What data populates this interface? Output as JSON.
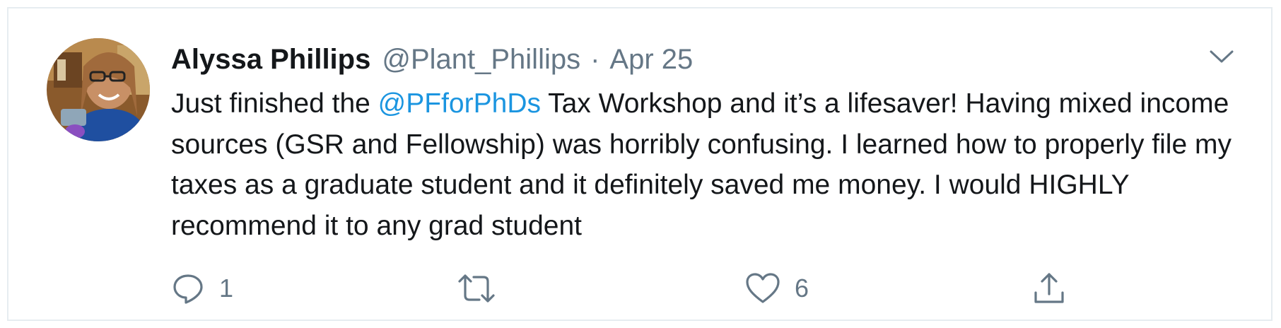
{
  "tweet": {
    "author": {
      "display_name": "Alyssa Phillips",
      "handle": "@Plant_Phillips"
    },
    "separator": "·",
    "date": "Apr 25",
    "text_segments": {
      "before_mention": "Just finished the ",
      "mention": "@PFforPhDs",
      "after_mention": " Tax Workshop and it’s a lifesaver! Having mixed income sources (GSR and Fellowship) was horribly confusing. I learned how to properly file my taxes as a graduate student and it definitely saved me money. I would HIGHLY recommend it to any grad student"
    },
    "actions": {
      "reply_count": "1",
      "retweet_count": "",
      "like_count": "6"
    }
  },
  "icons": {
    "caret": "chevron-down-icon",
    "reply": "reply-icon",
    "retweet": "retweet-icon",
    "like": "heart-icon",
    "share": "share-icon"
  },
  "colors": {
    "text": "#14171a",
    "secondary": "#657786",
    "link": "#1b95e0",
    "border": "#e6ecf0"
  }
}
